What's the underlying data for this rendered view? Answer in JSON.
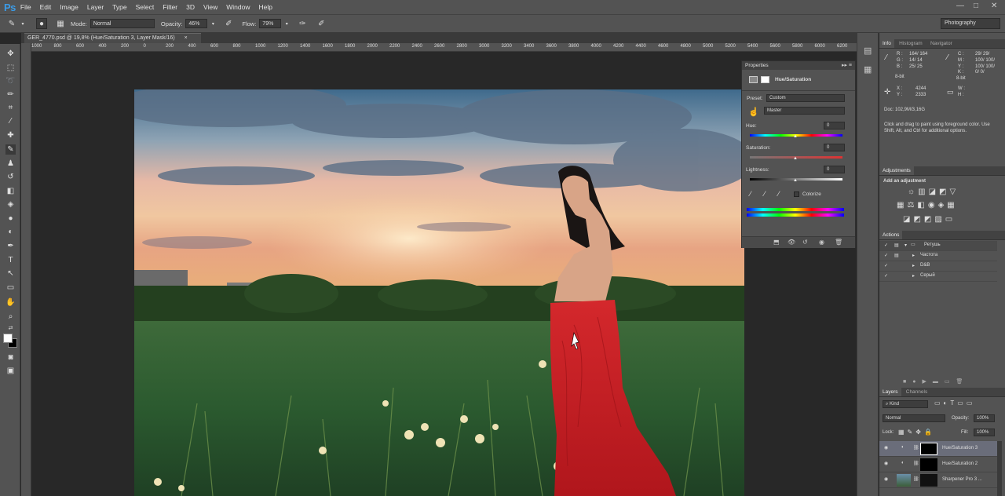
{
  "app": {
    "logo": "Ps"
  },
  "menu": [
    "File",
    "Edit",
    "Image",
    "Layer",
    "Type",
    "Select",
    "Filter",
    "3D",
    "View",
    "Window",
    "Help"
  ],
  "window_controls": {
    "minimize": "—",
    "maximize": "□",
    "close": "✕"
  },
  "options": {
    "mode_label": "Mode:",
    "mode_value": "Normal",
    "opacity_label": "Opacity:",
    "opacity_value": "46%",
    "flow_label": "Flow:",
    "flow_value": "79%",
    "workspace": "Photography"
  },
  "document": {
    "tab_title": "GER_4770.psd @ 19,8% (Hue/Saturation 3, Layer Mask/16)",
    "close": "×"
  },
  "ruler_labels": [
    "1000",
    "800",
    "600",
    "400",
    "200",
    "0",
    "200",
    "400",
    "600",
    "800",
    "1000",
    "1200",
    "1400",
    "1600",
    "1800",
    "2000",
    "2200",
    "2400",
    "2600",
    "2800",
    "3000",
    "3200",
    "3400",
    "3600",
    "3800",
    "4000",
    "4200",
    "4400",
    "4600",
    "4800",
    "5000",
    "5200",
    "5400",
    "5600",
    "5800",
    "6000",
    "6200"
  ],
  "properties": {
    "title": "Properties",
    "adjustment_name": "Hue/Saturation",
    "preset_label": "Preset:",
    "preset_value": "Custom",
    "channel_value": "Master",
    "hue_label": "Hue:",
    "hue_value": "0",
    "saturation_label": "Saturation:",
    "saturation_value": "0",
    "lightness_label": "Lightness:",
    "lightness_value": "0",
    "colorize_label": "Colorize"
  },
  "info": {
    "tabs": [
      "Info",
      "Histogram",
      "Navigator"
    ],
    "r_label": "R :",
    "r_values": "164/  164",
    "g_label": "G :",
    "g_values": "14/   14",
    "b_label": "B :",
    "b_values": "25/   25",
    "c_label": "C :",
    "c_values": "29/  29/",
    "m_label": "M :",
    "m_values": "100/  100/",
    "y_label": "Y :",
    "y_values": "100/  100/",
    "k_label": "K :",
    "k_values": "0/   0/",
    "bit_left": "8-bit",
    "bit_right": "8-bit",
    "x_label": "X :",
    "x_value": "4244",
    "y2_label": "Y :",
    "y2_value": "2333",
    "w_label": "W :",
    "h_label": "H :",
    "doc_size": "Doc: 102,9M/3,16G",
    "hint": "Click and drag to paint using foreground color. Use Shift, Alt, and Ctrl for additional options."
  },
  "adjustments": {
    "title": "Adjustments",
    "add_label": "Add an adjustment"
  },
  "actions": {
    "title": "Actions",
    "items": [
      "Ретушь",
      "Частота",
      "D&B",
      "Серый"
    ]
  },
  "layers": {
    "tabs": [
      "Layers",
      "Channels"
    ],
    "kind": "Kind",
    "blend": "Normal",
    "opacity_label": "Opacity:",
    "opacity_value": "100%",
    "lock_label": "Lock:",
    "fill_label": "Fill:",
    "fill_value": "100%",
    "items": [
      "Hue/Saturation 3",
      "Hue/Saturation 2",
      "Sharpener Pro 3 ..."
    ]
  },
  "colors": {
    "accent": "#3c9be6",
    "panel": "#535353",
    "dark": "#282828"
  }
}
